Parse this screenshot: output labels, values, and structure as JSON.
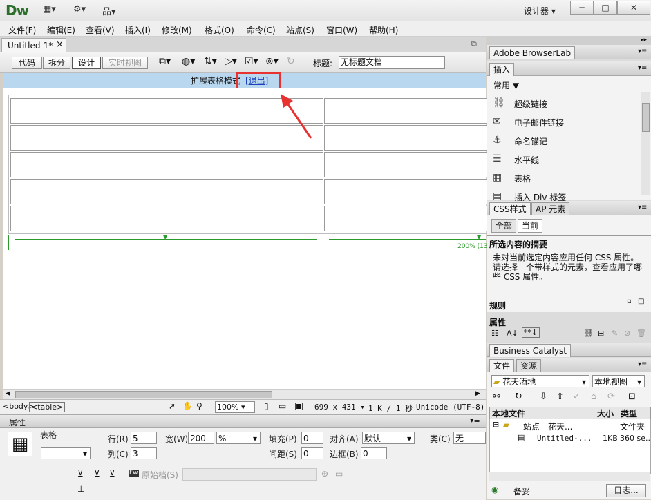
{
  "app": {
    "logo": "Dw",
    "workspace": "设计器",
    "win_min": "─",
    "win_max": "□",
    "win_close": "✕"
  },
  "menu": [
    "文件(F)",
    "编辑(E)",
    "查看(V)",
    "插入(I)",
    "修改(M)",
    "格式(O)",
    "命令(C)",
    "站点(S)",
    "窗口(W)",
    "帮助(H)"
  ],
  "document": {
    "tab": "Untitled-1*",
    "tab_close": "×",
    "title_label": "标题:",
    "title_value": "无标题文档"
  },
  "view_buttons": [
    "代码",
    "拆分",
    "设计",
    "实时视图"
  ],
  "banner": {
    "text": "扩展表格模式",
    "exit_link": "[退出]"
  },
  "table_width_label": "200% (13",
  "status": {
    "tags": [
      "<body>",
      "<table>"
    ],
    "zoom": "100%",
    "size": "699 x 431",
    "info": "1 K / 1 秒",
    "encoding": "Unicode (UTF-8)"
  },
  "properties": {
    "title": "属性",
    "element": "表格",
    "rows_label": "行(R)",
    "rows": "5",
    "cols_label": "列(C)",
    "cols": "3",
    "width_label": "宽(W)",
    "width": "200",
    "width_unit": "%",
    "padding_label": "填充(P)",
    "padding": "0",
    "spacing_label": "间距(S)",
    "spacing": "0",
    "align_label": "对齐(A)",
    "align": "默认",
    "border_label": "边框(B)",
    "border": "0",
    "class_label": "类(C)",
    "class": "无",
    "source_label": "原始档(S)"
  },
  "browserlab": {
    "title": "Adobe BrowserLab"
  },
  "insert_panel": {
    "tab": "插入",
    "category": "常用",
    "items": [
      "超级链接",
      "电子邮件链接",
      "命名锚记",
      "水平线",
      "表格",
      "插入 Div 标签"
    ]
  },
  "css_panel": {
    "tabs": [
      "CSS样式",
      "AP 元素"
    ],
    "mode_tabs": [
      "全部",
      "当前"
    ],
    "summary_title": "所选内容的摘要",
    "summary_text": "未对当前选定内容应用任何 CSS 属性。请选择一个带样式的元素，查看应用了哪些 CSS 属性。",
    "rules_label": "规则",
    "props_label": "属性"
  },
  "business_catalyst": {
    "title": "Business Catalyst"
  },
  "files_panel": {
    "tabs": [
      "文件",
      "资源"
    ],
    "site": "花天酒地",
    "view": "本地视图",
    "columns": [
      "本地文件",
      "大小",
      "类型"
    ],
    "rows": [
      {
        "name": "站点 - 花天...",
        "size": "",
        "type": "文件夹"
      },
      {
        "name": "Untitled-...",
        "size": "1KB",
        "type": "360 se..."
      }
    ],
    "footer_left": "备妥",
    "footer_right": "日志..."
  }
}
